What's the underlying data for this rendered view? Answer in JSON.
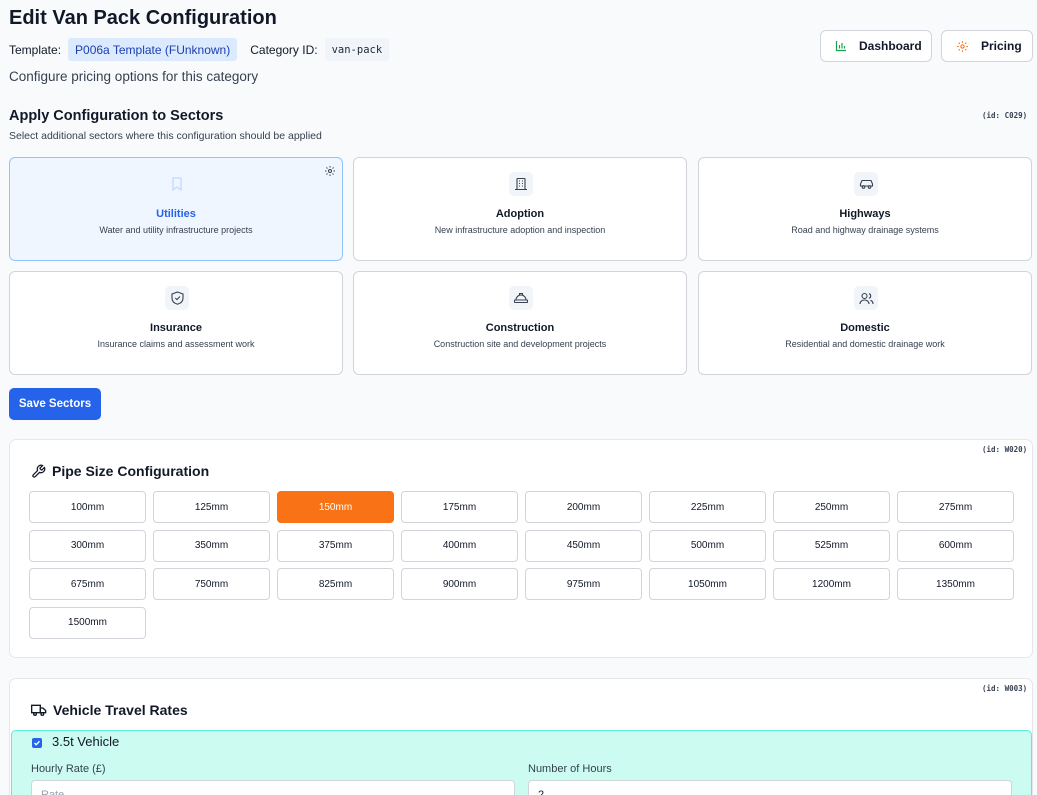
{
  "header": {
    "title": "Edit Van Pack Configuration",
    "template_label": "Template:",
    "template_value": "P006a Template (FUnknown)",
    "category_label": "Category ID:",
    "category_value": "van-pack",
    "subtitle": "Configure pricing options for this category",
    "dashboard_label": "Dashboard",
    "pricing_label": "Pricing"
  },
  "sectors": {
    "title": "Apply Configuration to Sectors",
    "subtitle": "Select additional sectors where this configuration should be applied",
    "id_tag": "(id: C029)",
    "items": [
      {
        "name": "Utilities",
        "desc": "Water and utility infrastructure projects",
        "icon": "bookmark-icon",
        "active": true
      },
      {
        "name": "Adoption",
        "desc": "New infrastructure adoption and inspection",
        "icon": "building-icon",
        "active": false
      },
      {
        "name": "Highways",
        "desc": "Road and highway drainage systems",
        "icon": "car-icon",
        "active": false
      },
      {
        "name": "Insurance",
        "desc": "Insurance claims and assessment work",
        "icon": "shield-check-icon",
        "active": false
      },
      {
        "name": "Construction",
        "desc": "Construction site and development projects",
        "icon": "hard-hat-icon",
        "active": false
      },
      {
        "name": "Domestic",
        "desc": "Residential and domestic drainage work",
        "icon": "users-icon",
        "active": false
      }
    ],
    "save_label": "Save Sectors"
  },
  "pipe": {
    "title": "Pipe Size Configuration",
    "id_tag": "(id: W020)",
    "selected": "150mm",
    "sizes": [
      "100mm",
      "125mm",
      "150mm",
      "175mm",
      "200mm",
      "225mm",
      "250mm",
      "275mm",
      "300mm",
      "350mm",
      "375mm",
      "400mm",
      "450mm",
      "500mm",
      "525mm",
      "600mm",
      "675mm",
      "750mm",
      "825mm",
      "900mm",
      "975mm",
      "1050mm",
      "1200mm",
      "1350mm",
      "1500mm"
    ]
  },
  "vehicle": {
    "title": "Vehicle Travel Rates",
    "id_tag": "(id: W003)",
    "vehicle_label": "3.5t Vehicle",
    "checked": true,
    "hourly_label": "Hourly Rate (£)",
    "hourly_placeholder": "Rate",
    "hours_label": "Number of Hours",
    "hours_value": "2"
  },
  "colors": {
    "primary": "#2563eb",
    "selected_pipe": "#f97316",
    "vehicle_bg": "#ccfbf1",
    "sector_active_bg": "#eff6ff"
  }
}
